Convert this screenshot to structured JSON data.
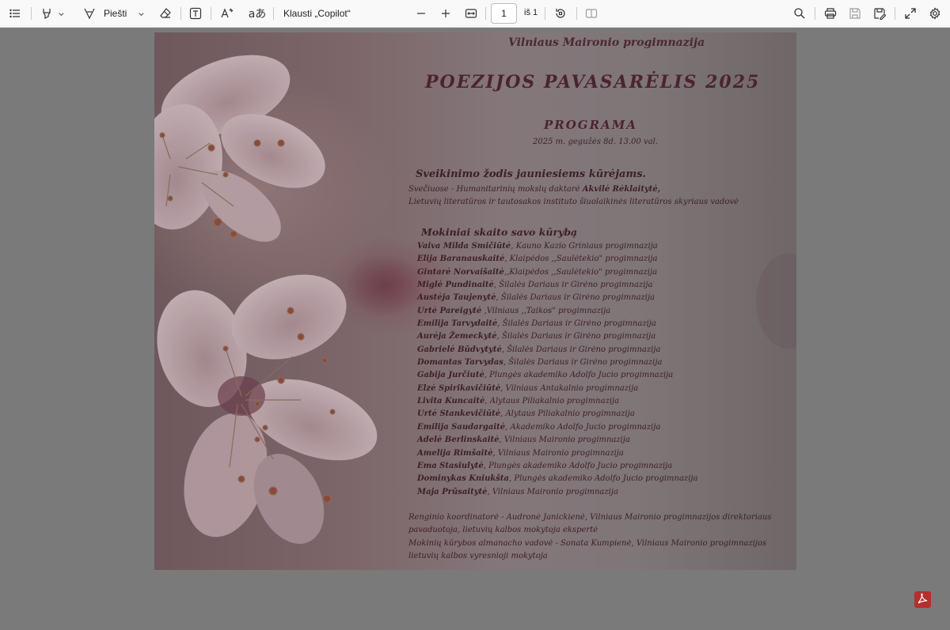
{
  "toolbar": {
    "draw_label": "Piešti",
    "copilot_label": "Klausti „Copilot“",
    "page_value": "1",
    "page_of": "iš 1"
  },
  "document": {
    "school": "Vilniaus Maironio progimnazija",
    "title": "POEZIJOS PAVASARĖLIS 2025",
    "program_heading": "PROGRAMA",
    "date": "2025 m. gegužės 8d. 13.00 val.",
    "welcome_heading": "Sveikinimo žodis jauniesiems kūrėjams.",
    "guest_line1_prefix": "Svečiuose  -  Humanitarinių mokslų daktarė ",
    "guest_line1_name": "Akvilė Rėklaitytė,",
    "guest_line2": "Lietuvių literatūros ir tautosakos instituto šiuolaikinės literatūros skyriaus vadovė",
    "students_heading": "Mokiniai skaito savo kūrybą",
    "students": [
      {
        "name": "Vaiva Milda Smičiūtė",
        "school": ", Kauno Kazio Griniaus progimnazija"
      },
      {
        "name": "Elija Baranauskaitė",
        "school": ", Klaipėdos ,,Saulėtekio\" progimnazija"
      },
      {
        "name": "Gintarė Norvaišaitė",
        "school": ",,Klaipėdos ,,Saulėtekio\" progimnazija"
      },
      {
        "name": "Miglė Pundinaitė",
        "school": ", Šilalės Dariaus ir Girėno progimnazija"
      },
      {
        "name": "Austėja Taujenytė",
        "school": ", Šilalės Dariaus ir Girėno progimnazija"
      },
      {
        "name": "Urtė Pareigytė",
        "school": " ,Vilniaus ,,Taikos\" progimnazija"
      },
      {
        "name": "Emilija Tarvydaitė",
        "school": ", Šilalės Dariaus ir Girėno progimnazija"
      },
      {
        "name": "Aurėja Žemeckytė",
        "school": ", Šilalės Dariaus ir Girėno progimnazija"
      },
      {
        "name": "Gabrielė Būdvytytė",
        "school": ", Šilalės Dariaus ir Girėno progimnazija"
      },
      {
        "name": "Domantas Tarvydas",
        "school": ", Šilalės Dariaus ir Girėno progimnazija"
      },
      {
        "name": "Gabija Jurčiutė",
        "school": ", Plungės akademiko Adolfo Jucio progimnazija"
      },
      {
        "name": "Elzė Spirikavičiūtė",
        "school": ", Vilniaus Antakalnio progimnazija"
      },
      {
        "name": "Livita Kuncaitė",
        "school": ",  Alytaus Piliakalnio progimnazija"
      },
      {
        "name": "Urtė Stankevičiūtė",
        "school": ", Alytaus Piliakalnio progimnazija"
      },
      {
        "name": "Emilija Saudargaitė",
        "school": ", Akademiko Adolfo Jucio progimnazija"
      },
      {
        "name": "Adelė Berlinskaitė",
        "school": ", Vilniaus Maironio progimnazija"
      },
      {
        "name": "Amelija Rimšaitė",
        "school": ", Vilniaus Maironio progimnazija"
      },
      {
        "name": "Ema Stasiulytė",
        "school": ", Plungės akademiko Adolfo Jucio progimnazija"
      },
      {
        "name": "Dominykas Kniukšta",
        "school": ",  Plungės akademiko Adolfo Jucio progimnazija"
      },
      {
        "name": "Maja Prūsaitytė",
        "school": ", Vilniaus Maironio progimnazija"
      }
    ],
    "coordinator_line1": "Renginio koordinatorė - Audronė Janickienė, Vilniaus Maironio progimnazijos direktoriaus",
    "coordinator_line2": "pavaduotoja, lietuvių kalbos mokytoja ekspertė",
    "almanac_line1": "Mokinių kūrybos almanacho vadovė - Sonata Kumpienė, Vilniaus Maironio progimnazijos",
    "almanac_line2": "lietuvių kalbos vyresnioji mokytoja"
  },
  "icons": {
    "contents": "list-icon",
    "highlight": "highlighter-icon",
    "draw": "pen-icon",
    "erase": "eraser-icon",
    "text": "text-box-icon",
    "read_aloud": "read-aloud-icon",
    "translate": "translate-icon",
    "zoom_out": "minus-icon",
    "zoom_in": "plus-icon",
    "fit": "fit-width-icon",
    "rotate": "rotate-icon",
    "two_page": "two-page-icon",
    "search": "search-icon",
    "print": "print-icon",
    "save": "save-icon",
    "save_as": "save-as-icon",
    "fullscreen": "fullscreen-icon",
    "settings": "gear-icon",
    "acrobat": "acrobat-icon"
  }
}
